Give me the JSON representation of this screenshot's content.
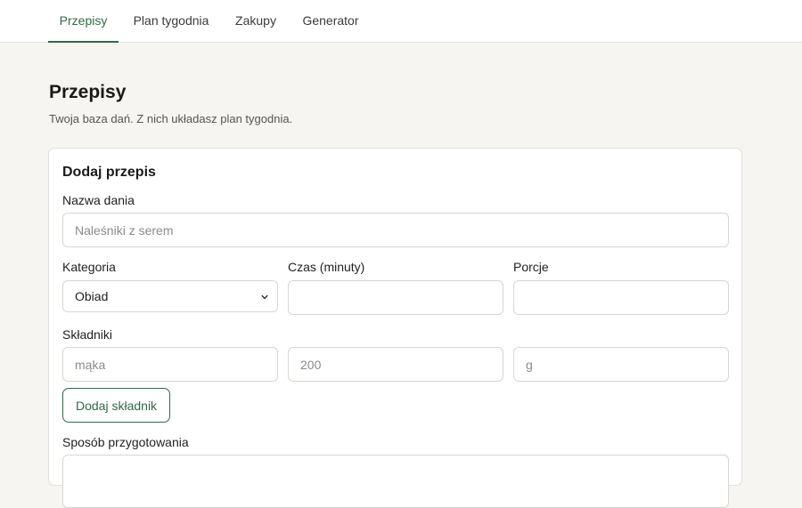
{
  "nav": {
    "tabs": [
      {
        "label": "Przepisy",
        "active": true
      },
      {
        "label": "Plan tygodnia",
        "active": false
      },
      {
        "label": "Zakupy",
        "active": false
      },
      {
        "label": "Generator",
        "active": false
      }
    ]
  },
  "header": {
    "title": "Przepisy",
    "subtitle": "Twoja baza dań. Z nich układasz plan tygodnia."
  },
  "form": {
    "title": "Dodaj przepis",
    "name_label": "Nazwa dania",
    "name_placeholder": "Naleśniki z serem",
    "category_label": "Kategoria",
    "category_value": "Obiad",
    "time_label": "Czas (minuty)",
    "time_value": "",
    "servings_label": "Porcje",
    "servings_value": "",
    "ingredients_label": "Składniki",
    "ingredient": {
      "name_placeholder": "mąka",
      "amount_placeholder": "200",
      "unit_placeholder": "g"
    },
    "add_ingredient_label": "Dodaj składnik",
    "method_label": "Sposób przygotowania"
  },
  "colors": {
    "accent": "#2f6b45",
    "background": "#f6f5f1",
    "card": "#ffffff"
  },
  "icons": {
    "select_arrow": "chevron-down-icon"
  }
}
